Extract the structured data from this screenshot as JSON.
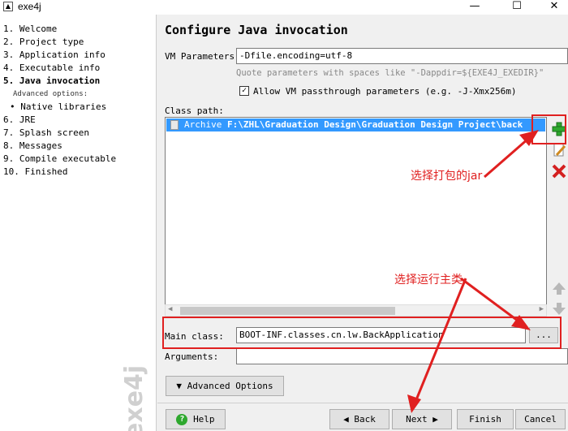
{
  "window": {
    "title": "exe4j",
    "minimize": "—",
    "maximize": "☐",
    "close": "✕"
  },
  "steps": [
    {
      "label": "1.  Welcome"
    },
    {
      "label": "2.  Project type"
    },
    {
      "label": "3.  Application info"
    },
    {
      "label": "4.  Executable info"
    },
    {
      "label": "5.  Java invocation"
    },
    {
      "label": "Advanced options:"
    },
    {
      "label": "• Native libraries"
    },
    {
      "label": "6.  JRE"
    },
    {
      "label": "7.  Splash screen"
    },
    {
      "label": "8.  Messages"
    },
    {
      "label": "9.  Compile executable"
    },
    {
      "label": "10.  Finished"
    }
  ],
  "watermark": "exe4j",
  "page_title": "Configure Java invocation",
  "vm": {
    "label": "VM Parameters:",
    "value": "-Dfile.encoding=utf-8",
    "hint": "Quote parameters with spaces like \"-Dappdir=${EXE4J_EXEDIR}\"",
    "passthrough_label": "Allow VM passthrough parameters (e.g. -J-Xmx256m)",
    "passthrough_checked": "✓"
  },
  "classpath": {
    "label": "Class path:",
    "entry_prefix": "Archive",
    "entry_path": "F:\\ZHL\\Graduation Design\\Graduation Design Project\\back"
  },
  "main_class": {
    "label": "Main class:",
    "value": "BOOT-INF.classes.cn.lw.BackApplication",
    "browse": "..."
  },
  "arguments": {
    "label": "Arguments:",
    "value": ""
  },
  "advanced_options": "Advanced Options",
  "buttons": {
    "help": "Help",
    "back": "Back",
    "next": "Next",
    "finish": "Finish",
    "cancel": "Cancel"
  },
  "annotations": {
    "jar": "选择打包的jar",
    "main": "选择运行主类"
  },
  "colors": {
    "selection": "#3399ff",
    "annotation": "#e02020",
    "add": "#2ea82e",
    "remove": "#d42020"
  }
}
